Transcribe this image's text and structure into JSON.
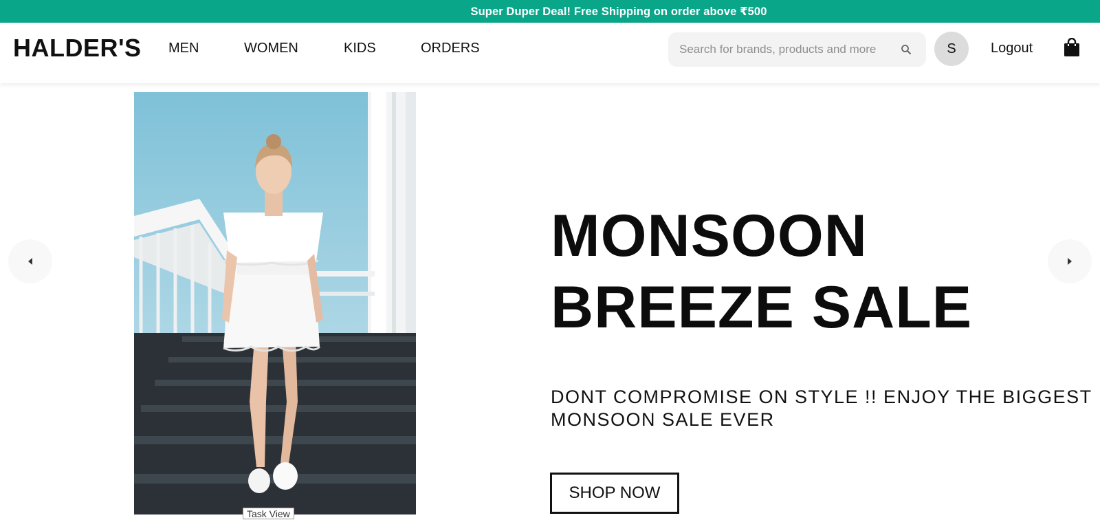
{
  "announcement": {
    "text": "Super Duper Deal! Free Shipping on order above ₹500"
  },
  "header": {
    "logo": "HALDER'S",
    "nav": [
      {
        "label": "MEN"
      },
      {
        "label": "WOMEN"
      },
      {
        "label": "KIDS"
      },
      {
        "label": "ORDERS"
      }
    ],
    "search": {
      "placeholder": "Search for brands, products and more",
      "value": "",
      "icon": "search-icon"
    },
    "avatar_initial": "S",
    "logout_label": "Logout",
    "cart_icon": "shopping-bag-icon"
  },
  "hero": {
    "title_line1": "MONSOON",
    "title_line2": "BREEZE SALE",
    "subtitle_line1": "DONT COMPROMISE ON STYLE !! ENJOY THE BIGGEST",
    "subtitle_line2": "MONSOON SALE EVER",
    "cta_label": "SHOP NOW",
    "prev_icon": "caret-left-icon",
    "next_icon": "caret-right-icon"
  },
  "tooltip": {
    "text": "Task View"
  },
  "colors": {
    "announcement_bg": "#0aa68a",
    "search_bg": "#f3f3f3",
    "avatar_bg": "#dcdcdc"
  }
}
